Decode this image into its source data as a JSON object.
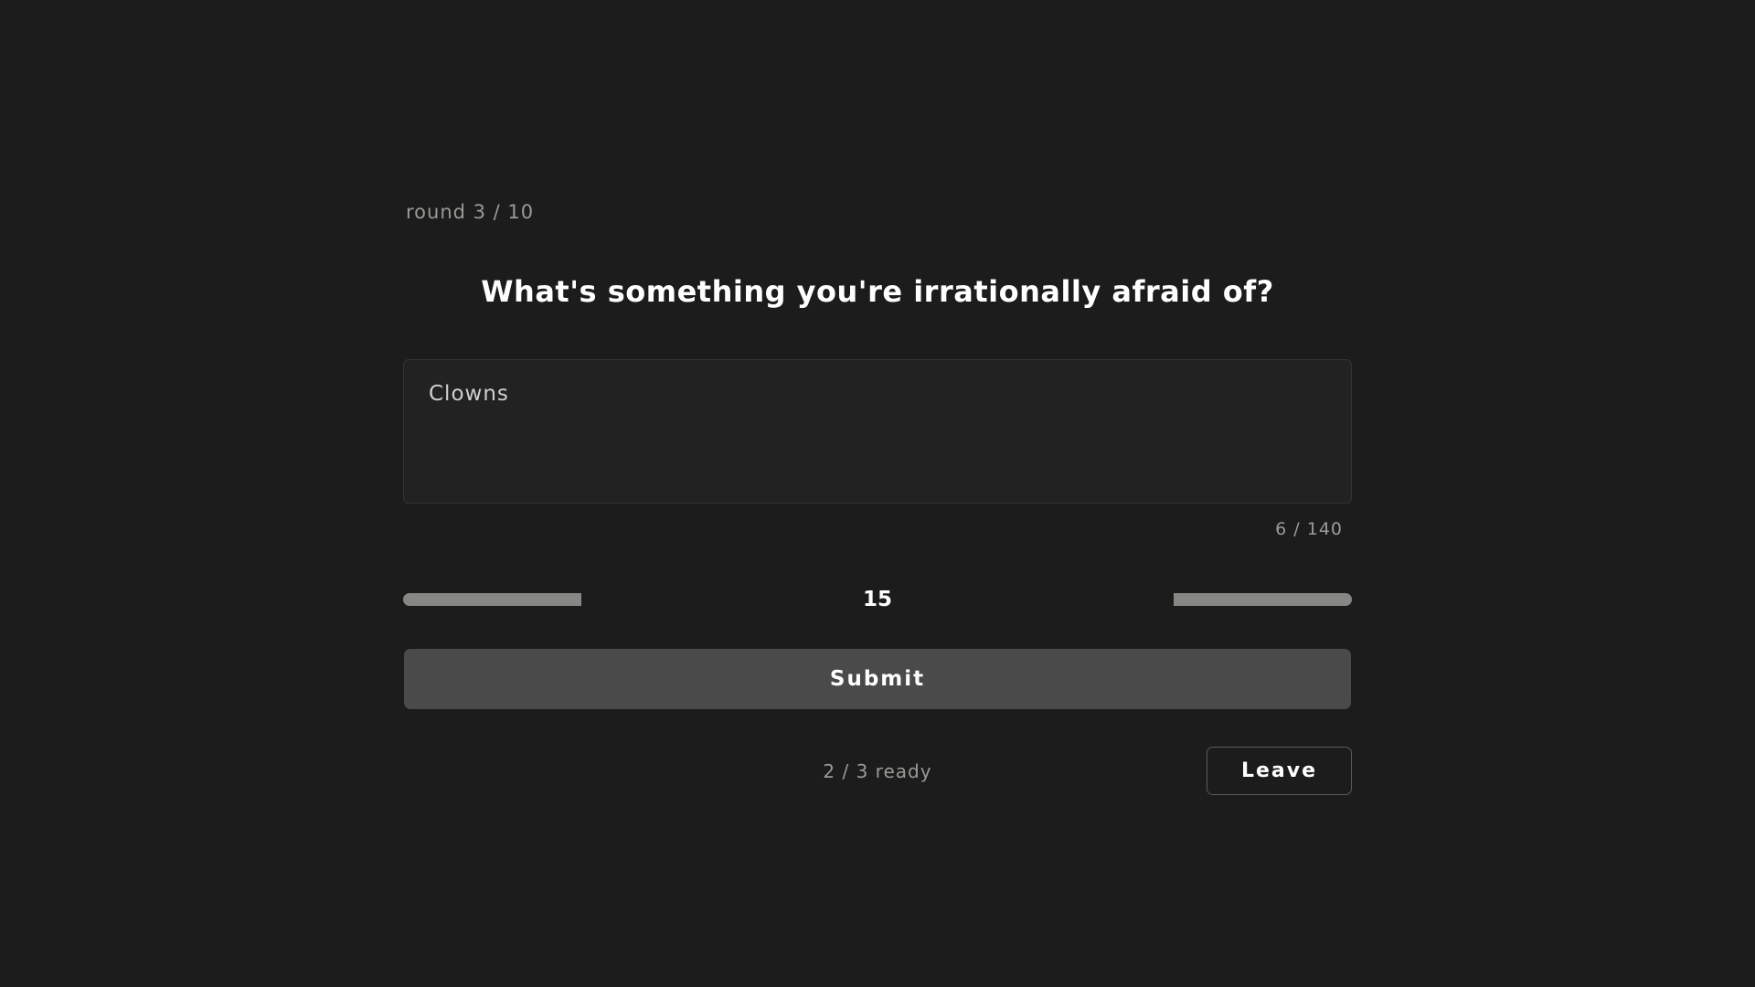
{
  "round": {
    "label": "round 3 / 10"
  },
  "prompt": {
    "question": "What's something you're irrationally afraid of?"
  },
  "answer": {
    "value": "Clowns",
    "char_count": "6 / 140"
  },
  "timer": {
    "seconds": "15",
    "remaining_fraction": 0.375
  },
  "actions": {
    "submit_label": "Submit",
    "leave_label": "Leave"
  },
  "status": {
    "ready": "2 / 3 ready"
  },
  "colors": {
    "background": "#1c1c1c",
    "timer_bar": "#878783",
    "submit_bg": "#4a4a4a",
    "muted_text": "#9a9a96"
  }
}
